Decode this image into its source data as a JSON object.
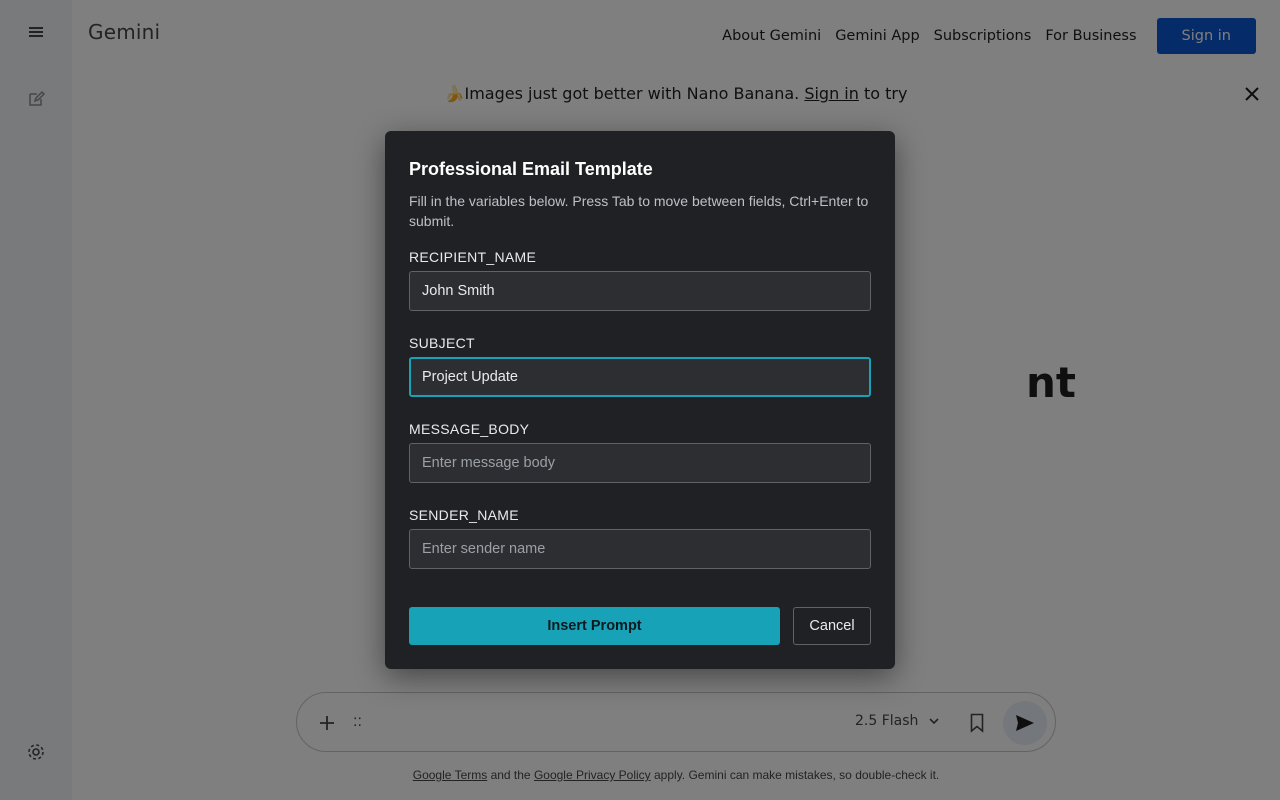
{
  "app": {
    "brand": "Gemini"
  },
  "topnav": {
    "links": [
      "About Gemini",
      "Gemini App",
      "Subscriptions",
      "For Business"
    ],
    "signin_label": "Sign in",
    "signin_color": "#0b57d0"
  },
  "banner": {
    "emoji": "🍌",
    "text_before": "Images just got better with Nano Banana. ",
    "link": "Sign in",
    "text_after": " to try"
  },
  "hero": {
    "visible_fragment": "nt"
  },
  "composer": {
    "drag_glyph": "::",
    "model_label": "2.5 Flash"
  },
  "footer": {
    "link_terms": "Google Terms",
    "mid": " and the ",
    "link_privacy": "Google Privacy Policy",
    "tail": " apply. Gemini can make mistakes, so double-check it."
  },
  "modal": {
    "title": "Professional Email Template",
    "description": "Fill in the variables below. Press Tab to move between fields, Ctrl+Enter to submit.",
    "fields": [
      {
        "label": "RECIPIENT_NAME",
        "value": "John Smith",
        "placeholder": ""
      },
      {
        "label": "SUBJECT",
        "value": "Project Update",
        "placeholder": ""
      },
      {
        "label": "MESSAGE_BODY",
        "value": "",
        "placeholder": "Enter message body"
      },
      {
        "label": "SENDER_NAME",
        "value": "",
        "placeholder": "Enter sender name"
      }
    ],
    "insert_label": "Insert Prompt",
    "cancel_label": "Cancel",
    "accent_color": "#17a2b8"
  }
}
